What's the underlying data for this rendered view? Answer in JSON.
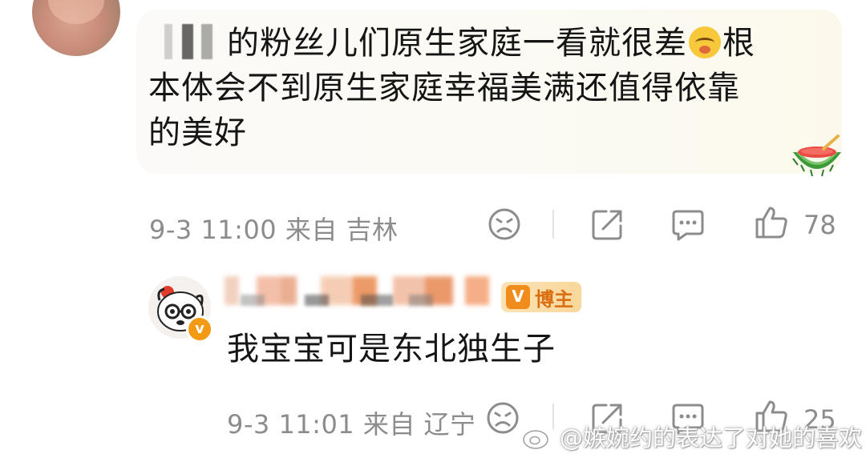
{
  "top_comment": {
    "text_line1": "的粉丝儿们原生家庭一看就很差",
    "text_line1_end": "根",
    "text_line2": "本体会不到原生家庭幸福美满还值得依靠",
    "text_line3": "的美好",
    "emoji_name": "crying-face-emoji",
    "sticker_name": "watermelon-sticker",
    "meta": "9-3 11:00 来自 吉林",
    "like_count": "78"
  },
  "reply": {
    "badge_label": "博主",
    "text": "我宝宝可是东北独生子",
    "meta": "9-3 11:01 来自 辽宁",
    "like_count": "25"
  },
  "watermark": "@嫉婉约的表达了对她的喜欢",
  "colors": {
    "meta_gray": "#8c8c8c",
    "badge_orange": "#d96d10",
    "verified_orange": "#f39a14"
  }
}
